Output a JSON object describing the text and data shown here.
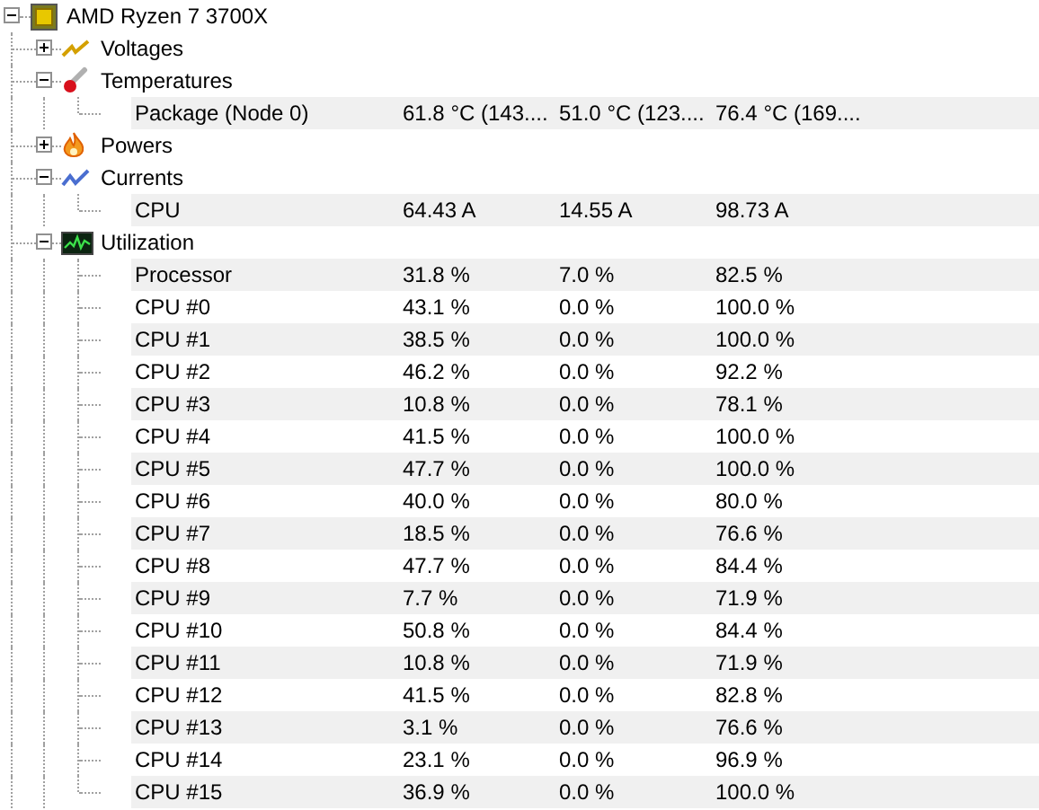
{
  "tree": [
    {
      "label": "AMD Ryzen 7 3700X",
      "kind": "chip",
      "expanded": true,
      "children": [
        {
          "label": "Voltages",
          "kind": "voltage",
          "expanded": false
        },
        {
          "label": "Temperatures",
          "kind": "thermometer",
          "expanded": true,
          "children": [
            {
              "label": "Package (Node 0)",
              "values": [
                "61.8 °C (143....",
                "51.0 °C (123....",
                "76.4 °C (169...."
              ]
            }
          ]
        },
        {
          "label": "Powers",
          "kind": "flame",
          "expanded": false
        },
        {
          "label": "Currents",
          "kind": "current",
          "expanded": true,
          "children": [
            {
              "label": "CPU",
              "values": [
                "64.43 A",
                "14.55 A",
                "98.73 A"
              ]
            }
          ]
        },
        {
          "label": "Utilization",
          "kind": "graph",
          "expanded": true,
          "children": [
            {
              "label": "Processor",
              "values": [
                "31.8 %",
                "7.0 %",
                "82.5 %"
              ]
            },
            {
              "label": "CPU #0",
              "values": [
                "43.1 %",
                "0.0 %",
                "100.0 %"
              ]
            },
            {
              "label": "CPU #1",
              "values": [
                "38.5 %",
                "0.0 %",
                "100.0 %"
              ]
            },
            {
              "label": "CPU #2",
              "values": [
                "46.2 %",
                "0.0 %",
                "92.2 %"
              ]
            },
            {
              "label": "CPU #3",
              "values": [
                "10.8 %",
                "0.0 %",
                "78.1 %"
              ]
            },
            {
              "label": "CPU #4",
              "values": [
                "41.5 %",
                "0.0 %",
                "100.0 %"
              ]
            },
            {
              "label": "CPU #5",
              "values": [
                "47.7 %",
                "0.0 %",
                "100.0 %"
              ]
            },
            {
              "label": "CPU #6",
              "values": [
                "40.0 %",
                "0.0 %",
                "80.0 %"
              ]
            },
            {
              "label": "CPU #7",
              "values": [
                "18.5 %",
                "0.0 %",
                "76.6 %"
              ]
            },
            {
              "label": "CPU #8",
              "values": [
                "47.7 %",
                "0.0 %",
                "84.4 %"
              ]
            },
            {
              "label": "CPU #9",
              "values": [
                "7.7 %",
                "0.0 %",
                "71.9 %"
              ]
            },
            {
              "label": "CPU #10",
              "values": [
                "50.8 %",
                "0.0 %",
                "84.4 %"
              ]
            },
            {
              "label": "CPU #11",
              "values": [
                "10.8 %",
                "0.0 %",
                "71.9 %"
              ]
            },
            {
              "label": "CPU #12",
              "values": [
                "41.5 %",
                "0.0 %",
                "82.8 %"
              ]
            },
            {
              "label": "CPU #13",
              "values": [
                "3.1 %",
                "0.0 %",
                "76.6 %"
              ]
            },
            {
              "label": "CPU #14",
              "values": [
                "23.1 %",
                "0.0 %",
                "96.9 %"
              ]
            },
            {
              "label": "CPU #15",
              "values": [
                "36.9 %",
                "0.0 %",
                "100.0 %"
              ]
            }
          ]
        }
      ]
    }
  ]
}
